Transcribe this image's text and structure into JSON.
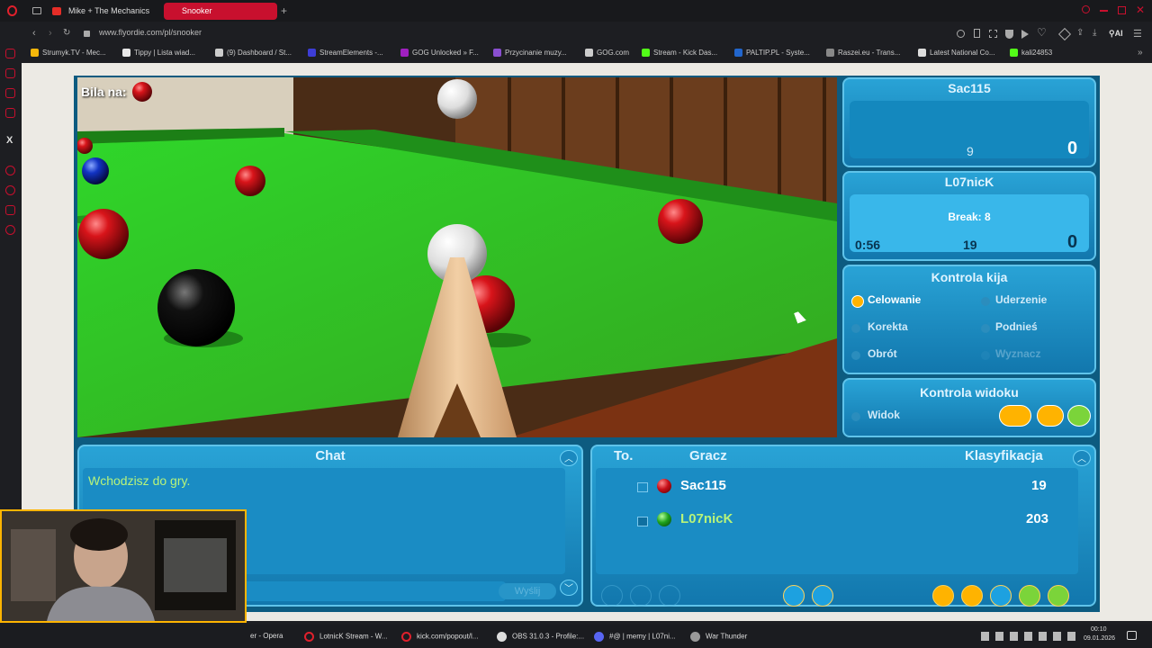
{
  "browser": {
    "tabs": [
      {
        "label": "Mike + The Mechanics"
      },
      {
        "label": "Snooker"
      }
    ],
    "url": "www.flyordie.com/pl/snooker",
    "bookmarks": [
      "Strumyk.TV - Mec...",
      "Tippy | Lista wiad...",
      "(9) Dashboard / St...",
      "StreamElements -...",
      "GOG Unlocked » F...",
      "Przycinanie muzy...",
      "GOG.com",
      "Stream - Kick Das...",
      "PALTIP.PL - Syste...",
      "Raszei.eu - Trans...",
      "Latest National Co...",
      "kali24853"
    ]
  },
  "game": {
    "bila_label": "Bila na:",
    "player1": {
      "name": "Sac115",
      "center_score": "9",
      "score": "0"
    },
    "player2": {
      "name": "L07nicK",
      "break": "Break: 8",
      "timer": "0:56",
      "center_score": "19",
      "score": "0"
    },
    "cue_control": {
      "title": "Kontrola kija",
      "items": [
        "Celowanie",
        "Uderzenie",
        "Korekta",
        "Podnieś",
        "Obrót",
        "Wyznacz"
      ]
    },
    "view_control": {
      "title": "Kontrola widoku",
      "item": "Widok"
    },
    "chat": {
      "title": "Chat",
      "message": "Wchodzisz do gry.",
      "send": "Wyślij"
    },
    "players": {
      "col_to": "To.",
      "col_player": "Gracz",
      "col_rank": "Klasyfikacja",
      "rows": [
        {
          "name": "Sac115",
          "rank": "19"
        },
        {
          "name": "L07nicK",
          "rank": "203"
        }
      ]
    }
  },
  "taskbar": {
    "items": [
      "er - Opera",
      "LotnicK Stream - W...",
      "kick.com/popout/l...",
      "OBS 31.0.3 - Profile:...",
      "#@ | memy | L07ni...",
      "War Thunder"
    ],
    "time": "00:10",
    "date": "09.01.2026"
  },
  "colors": {
    "accent": "#c8102e",
    "panel": "#1a8cc4",
    "felt": "#3bbf2c"
  }
}
